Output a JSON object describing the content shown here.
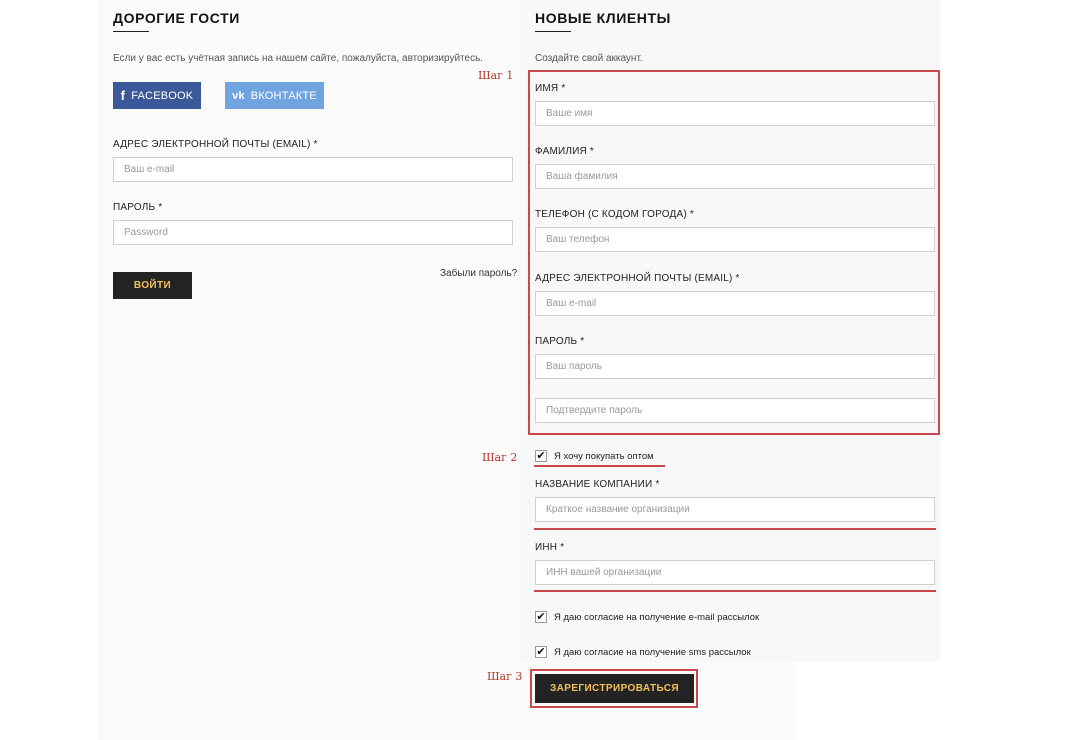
{
  "login": {
    "title": "ДОРОГИЕ ГОСТИ",
    "intro": "Если у вас есть учётная запись на нашем сайте, пожалуйста, авторизируйтесь.",
    "facebook_label": "FACEBOOK",
    "vk_label": "ВКОНТАКТЕ",
    "email_label": "АДРЕС ЭЛЕКТРОННОЙ ПОЧТЫ (EMAIL) *",
    "email_placeholder": "Ваш e-mail",
    "password_label": "ПАРОЛЬ *",
    "password_placeholder": "Password",
    "login_button": "ВОЙТИ",
    "forgot_link": "Забыли пароль?"
  },
  "register": {
    "title": "НОВЫЕ КЛИЕНТЫ",
    "intro": "Создайте свой аккаунт.",
    "name_label": "ИМЯ *",
    "name_placeholder": "Ваше имя",
    "surname_label": "ФАМИЛИЯ *",
    "surname_placeholder": "Ваша фамилия",
    "phone_label": "ТЕЛЕФОН (С КОДОМ ГОРОДА) *",
    "phone_placeholder": "Ваш телефон",
    "email_label": "АДРЕС ЭЛЕКТРОННОЙ ПОЧТЫ (EMAIL) *",
    "email_placeholder": "Ваш e-mail",
    "password_label": "ПАРОЛЬ *",
    "password_placeholder": "Ваш пароль",
    "confirm_placeholder": "Подтвердите пароль",
    "wholesale_label": "Я хочу покупать оптом",
    "wholesale_checked": true,
    "company_label": "НАЗВАНИЕ КОМПАНИИ *",
    "company_placeholder": "Краткое название организации",
    "inn_label": "ИНН *",
    "inn_placeholder": "ИНН вашей организации",
    "email_consent_label": "Я даю согласие на получение e-mail рассылок",
    "email_consent_checked": true,
    "sms_consent_label": "Я даю согласие на получение sms рассылок",
    "sms_consent_checked": true,
    "submit_button": "ЗАРЕГИСТРИРОВАТЬСЯ"
  },
  "annotations": {
    "step1": "Шаг 1",
    "step2": "Шаг 2",
    "step3": "Шаг 3",
    "highlight_color": "#c9484b"
  },
  "icons": {
    "facebook": "facebook-icon",
    "vk": "vk-icon",
    "check": "checkmark-icon"
  },
  "colors": {
    "facebook": "#3b5998",
    "vk": "#6fa4e0",
    "dark_button": "#232323",
    "button_text": "#f2c15c"
  }
}
